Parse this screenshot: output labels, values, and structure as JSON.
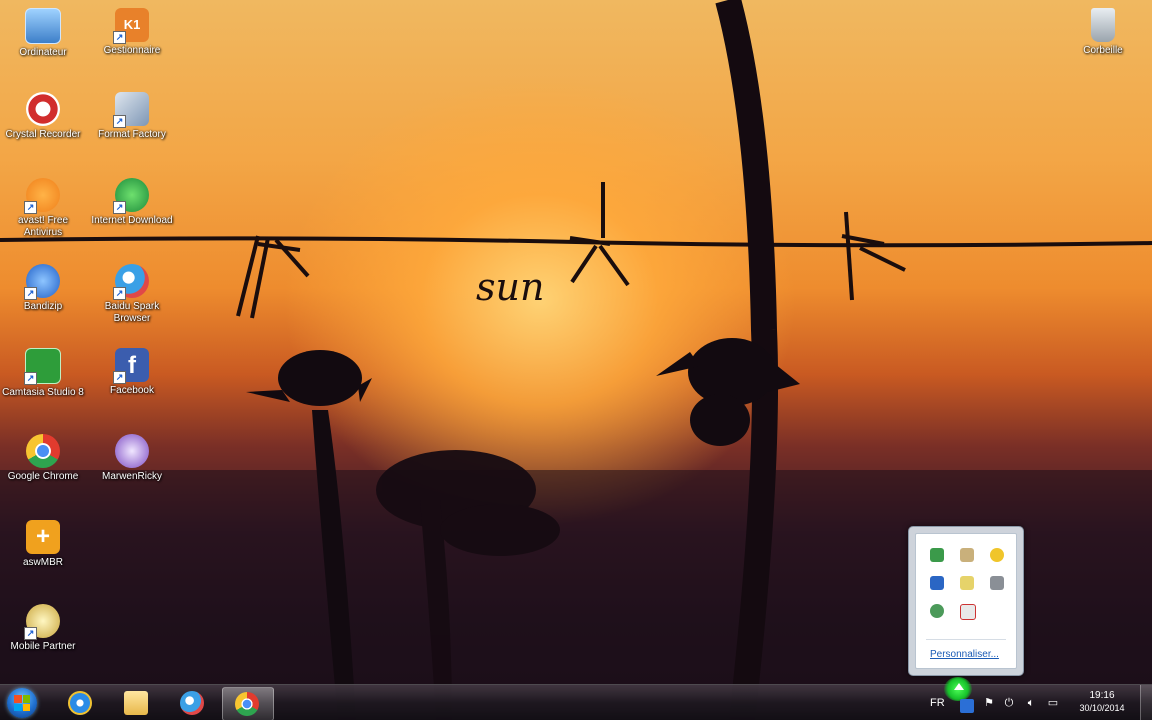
{
  "desktop": {
    "wallpaper_text": "sun",
    "icons": [
      {
        "label": "Ordinateur",
        "icon": "computer-icon"
      },
      {
        "label": "Gestionnaire",
        "icon": "k1-app-icon"
      },
      {
        "label": "Corbeille",
        "icon": "recycle-bin-icon"
      },
      {
        "label": "Crystal Recorder",
        "icon": "recorder-icon"
      },
      {
        "label": "Format Factory",
        "icon": "format-factory-icon"
      },
      {
        "label": "avast! Free Antivirus",
        "icon": "avast-icon"
      },
      {
        "label": "Internet Download",
        "icon": "internet-download-icon"
      },
      {
        "label": "Bandizip",
        "icon": "bandizip-icon"
      },
      {
        "label": "Baidu Spark Browser",
        "icon": "baidu-spark-icon"
      },
      {
        "label": "Camtasia Studio 8",
        "icon": "camtasia-icon"
      },
      {
        "label": "Facebook",
        "icon": "facebook-icon"
      },
      {
        "label": "Google Chrome",
        "icon": "chrome-icon"
      },
      {
        "label": "MarwenRicky",
        "icon": "user-folder-icon"
      },
      {
        "label": "aswMBR",
        "icon": "aswmbr-icon"
      },
      {
        "label": "Mobile Partner",
        "icon": "mobile-partner-icon"
      }
    ]
  },
  "tray_popup": {
    "customize_label": "Personnaliser..."
  },
  "taskbar": {
    "pinned": [
      "internet-explorer-icon",
      "explorer-folder-icon",
      "baidu-spark-icon",
      "chrome-icon"
    ],
    "active_app": "chrome-icon",
    "clock_time": "19:16",
    "clock_date": "30/10/2014"
  },
  "colors": {
    "accent_green": "#16c12a",
    "sky_top": "#f0b860",
    "sun_core": "#ffd678"
  }
}
